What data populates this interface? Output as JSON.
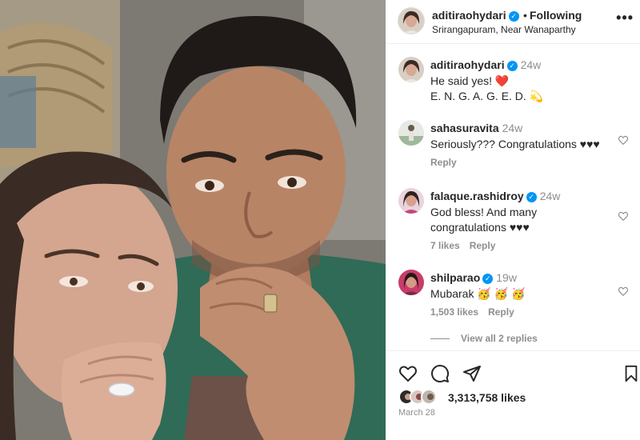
{
  "post": {
    "username": "aditiraohydari",
    "follow_state": "Following",
    "location": "Srirangapuram, Near Wanaparthy",
    "separator": "•",
    "more_label": "•••"
  },
  "comments": [
    {
      "username": "aditiraohydari",
      "verified": true,
      "time": "24w",
      "lines": [
        "He said yes! ❤️",
        "E. N. G. A. G. E. D. 💫"
      ]
    },
    {
      "username": "sahasuravita",
      "verified": false,
      "time": "24w",
      "lines": [
        "Seriously??? Congratulations ♥♥♥"
      ],
      "reply_label": "Reply"
    },
    {
      "username": "falaque.rashidroy",
      "verified": true,
      "time": "24w",
      "lines": [
        "God bless! And many",
        "congratulations ♥♥♥"
      ],
      "likes_label": "7 likes",
      "reply_label": "Reply"
    },
    {
      "username": "shilparao",
      "verified": true,
      "time": "19w",
      "lines": [
        "Mubarak 🥳 🥳 🥳"
      ],
      "likes_label": "1,503 likes",
      "reply_label": "Reply"
    }
  ],
  "view_replies_label": "View all 2 replies",
  "likes": "3,313,758 likes",
  "date": "March 28",
  "icons": {
    "like": "heart-icon",
    "comment": "comment-icon",
    "share": "share-icon",
    "save": "bookmark-icon",
    "verified": "verified-badge-icon",
    "more": "more-options-icon"
  },
  "colors": {
    "verified_blue": "#0095f6",
    "text": "#262626",
    "secondary": "#8e8e8e"
  }
}
